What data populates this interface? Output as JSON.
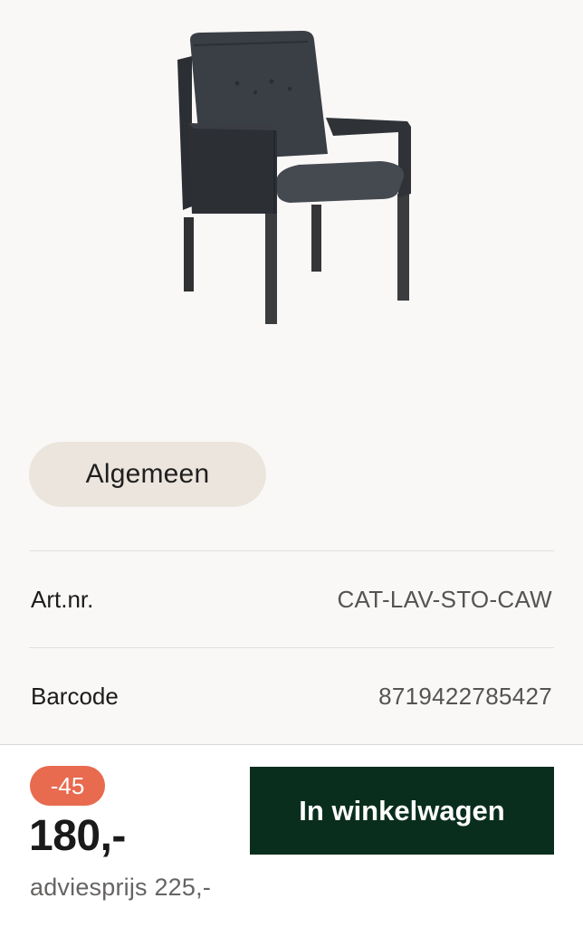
{
  "product": {
    "image_alt": "Dark grey dining armchair with black legs"
  },
  "tabs": {
    "active_label": "Algemeen"
  },
  "specs": [
    {
      "label": "Art.nr.",
      "value": "CAT-LAV-STO-CAW"
    },
    {
      "label": "Barcode",
      "value": "8719422785427"
    }
  ],
  "pricing": {
    "discount_badge": "-45",
    "price": "180,-",
    "advice_label": "adviesprijs",
    "advice_price": "225,-"
  },
  "actions": {
    "add_to_cart_label": "In winkelwagen"
  },
  "colors": {
    "background": "#faf8f6",
    "pill_background": "#ece5dd",
    "badge": "#e86a4f",
    "button": "#0a2e1e"
  }
}
